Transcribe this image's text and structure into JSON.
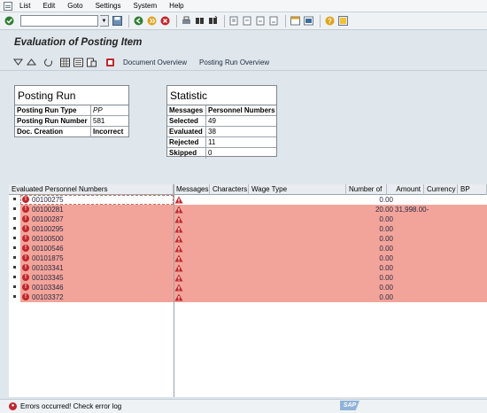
{
  "menu": [
    "List",
    "Edit",
    "Goto",
    "Settings",
    "System",
    "Help"
  ],
  "title": "Evaluation of Posting Item",
  "app_toolbar": {
    "document_overview": "Document Overview",
    "posting_run_overview": "Posting Run Overview"
  },
  "posting_run": {
    "title": "Posting Run",
    "rows": [
      {
        "label": "Posting Run Type",
        "value": "PP"
      },
      {
        "label": "Posting Run Number",
        "value": "581"
      },
      {
        "label": "Doc. Creation",
        "value": "Incorrect"
      }
    ]
  },
  "statistic": {
    "title": "Statistic",
    "header": {
      "label": "Messages",
      "value": "Personnel Numbers"
    },
    "rows": [
      {
        "label": "Selected",
        "value": "49"
      },
      {
        "label": "Evaluated",
        "value": "38"
      },
      {
        "label": "Rejected",
        "value": "11"
      },
      {
        "label": "Skipped",
        "value": "0"
      }
    ]
  },
  "grid": {
    "columns": {
      "evaluated": "Evaluated Personnel Numbers",
      "messages": "Messages",
      "characters": "Characters",
      "wage_type": "Wage Type",
      "number_of": "Number of",
      "amount": "Amount",
      "currency": "Currency",
      "bp": "BP"
    },
    "rows": [
      {
        "pernr": "00100275",
        "number": "0.00",
        "amount": ""
      },
      {
        "pernr": "00100281",
        "number": "20.00",
        "amount": "31,998.00-"
      },
      {
        "pernr": "00100287",
        "number": "0.00",
        "amount": ""
      },
      {
        "pernr": "00100295",
        "number": "0.00",
        "amount": ""
      },
      {
        "pernr": "00100500",
        "number": "0.00",
        "amount": ""
      },
      {
        "pernr": "00100546",
        "number": "0.00",
        "amount": ""
      },
      {
        "pernr": "00101875",
        "number": "0.00",
        "amount": ""
      },
      {
        "pernr": "00103341",
        "number": "0.00",
        "amount": ""
      },
      {
        "pernr": "00103345",
        "number": "0.00",
        "amount": ""
      },
      {
        "pernr": "00103346",
        "number": "0.00",
        "amount": ""
      },
      {
        "pernr": "00103372",
        "number": "0.00",
        "amount": ""
      }
    ]
  },
  "status": {
    "message": "Errors occurred! Check error log",
    "logo": "SAP"
  },
  "colors": {
    "error_row": "#f3a49a",
    "error_icon": "#c0272d",
    "background": "#dfe6ec"
  }
}
